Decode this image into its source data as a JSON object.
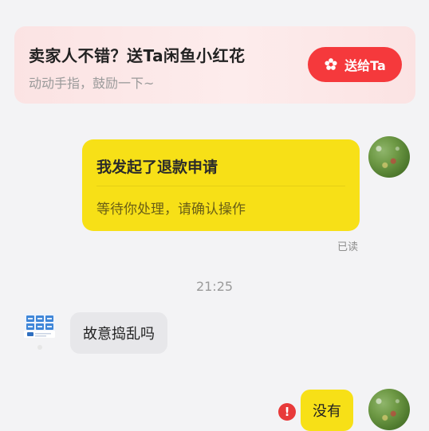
{
  "promo": {
    "title": "卖家人不错？送Ta闲鱼小红花",
    "subtitle": "动动手指，鼓励一下~",
    "button_label": "送给Ta",
    "button_icon": "flower-icon",
    "accent_color": "#f5393c"
  },
  "messages": {
    "request_card": {
      "title": "我发起了退款申请",
      "subtitle": "等待你处理，请确认操作"
    },
    "read_status": "已读",
    "timestamp": "21:25",
    "incoming_text": "故意捣乱吗",
    "outgoing_text": "没有",
    "error_icon": "!"
  }
}
